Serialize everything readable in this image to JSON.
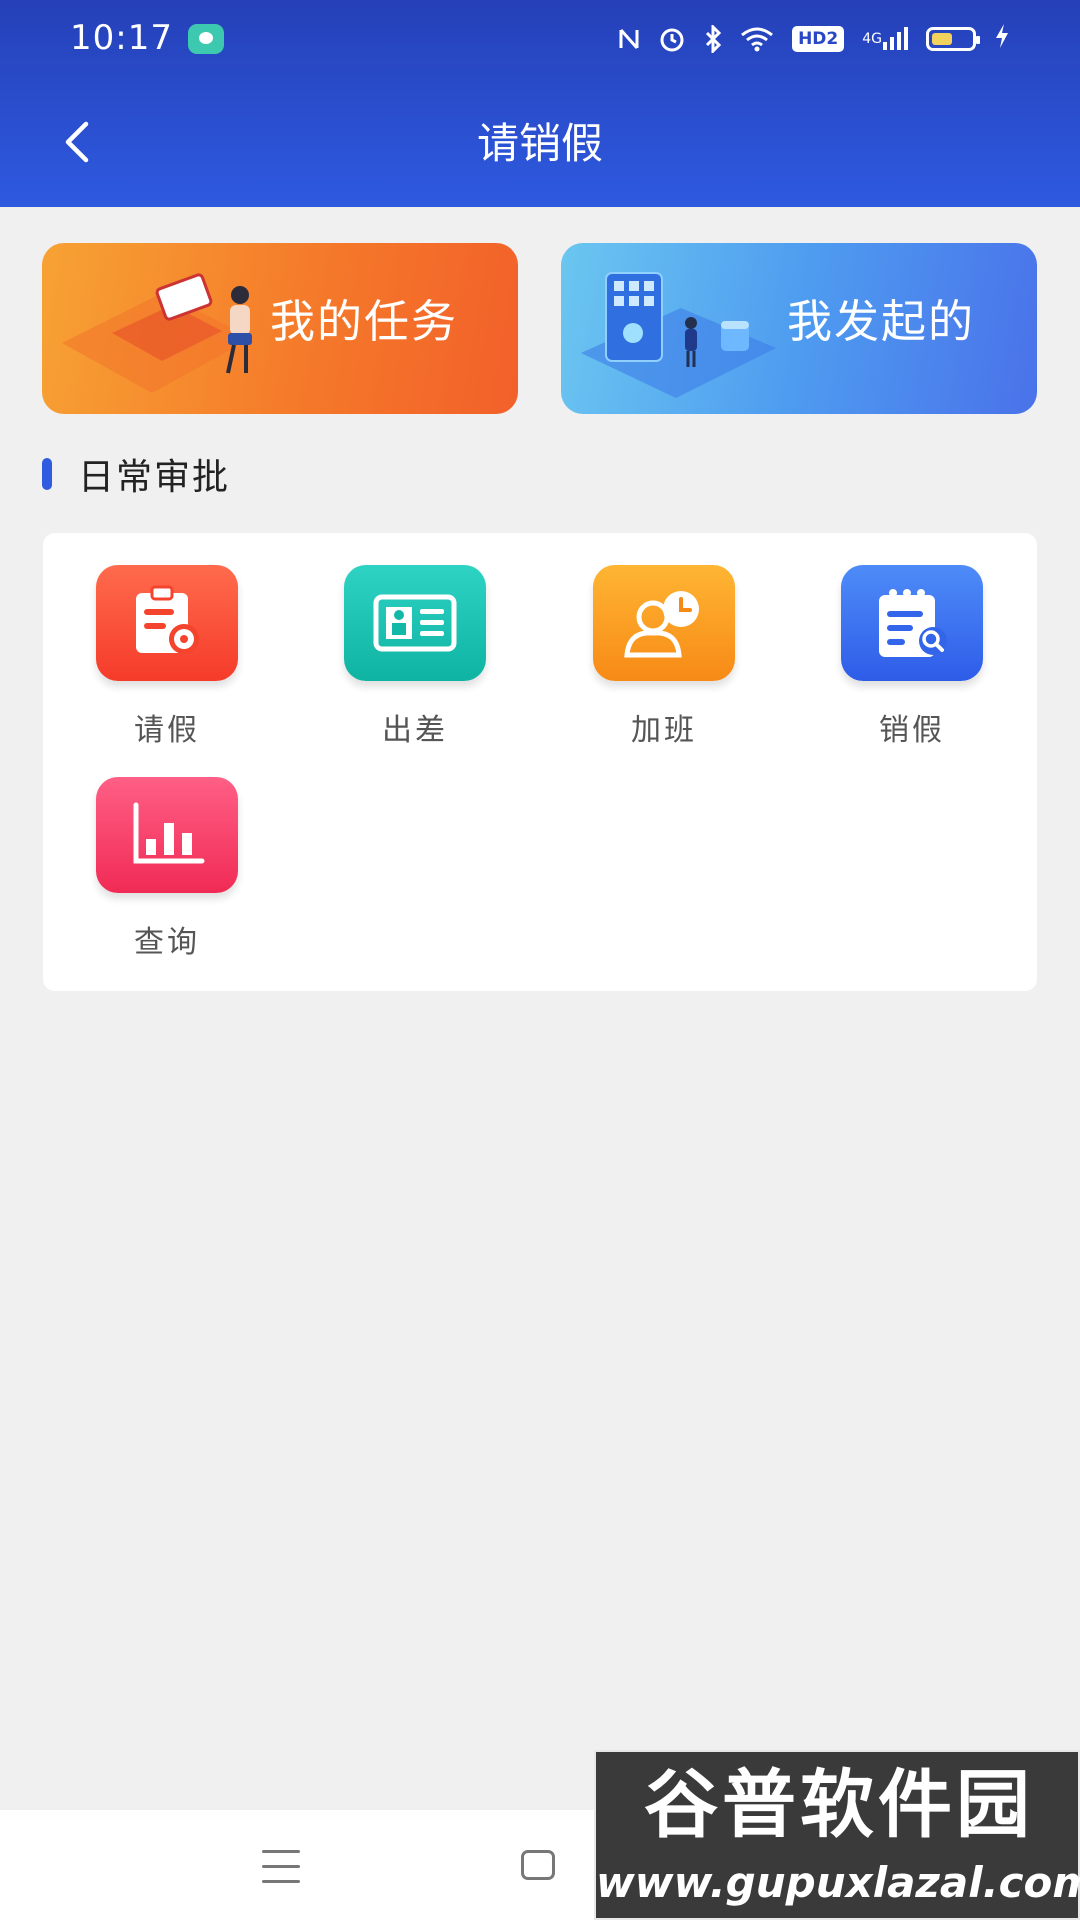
{
  "status_bar": {
    "time": "10:17",
    "hd_badge": "HD2",
    "network": "4G"
  },
  "header": {
    "title": "请销假"
  },
  "cards": {
    "task_label": "我的任务",
    "mine_label": "我发起的"
  },
  "section": {
    "title": "日常审批"
  },
  "grid": [
    {
      "label": "请假",
      "icon": "leave-request-icon",
      "color": "#f53b2a"
    },
    {
      "label": "出差",
      "icon": "business-trip-icon",
      "color": "#0fb3a2"
    },
    {
      "label": "加班",
      "icon": "overtime-icon",
      "color": "#f78a16"
    },
    {
      "label": "销假",
      "icon": "cancel-leave-icon",
      "color": "#2e5ce8"
    },
    {
      "label": "查询",
      "icon": "query-chart-icon",
      "color": "#f02b55"
    }
  ],
  "watermark": {
    "title": "谷普软件园",
    "url": "www.gupuxlazal.com"
  },
  "colors": {
    "header": "#2a48c6",
    "accent": "#2f5be0",
    "background": "#f0f0f0"
  }
}
